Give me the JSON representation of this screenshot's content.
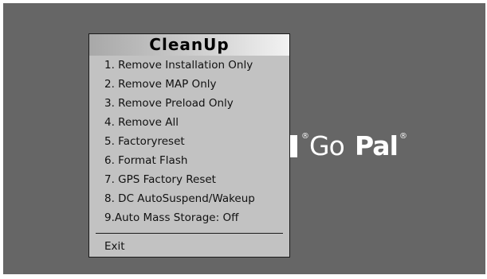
{
  "background": {
    "logo": {
      "reg_mark_1": "®",
      "brand_prefix": "Go",
      "brand_suffix": "Pal",
      "reg_mark_2": "®"
    }
  },
  "dialog": {
    "title": "CleanUp",
    "items": [
      {
        "label": "1. Remove Installation Only"
      },
      {
        "label": "2. Remove MAP Only"
      },
      {
        "label": "3. Remove Preload Only"
      },
      {
        "label": "4. Remove All"
      },
      {
        "label": "5. Factoryreset"
      },
      {
        "label": "6. Format Flash"
      },
      {
        "label": "7. GPS Factory Reset"
      },
      {
        "label": "8. DC AutoSuspend/Wakeup"
      },
      {
        "label": "9.Auto Mass Storage: Off"
      }
    ],
    "exit_label": "Exit"
  },
  "colors": {
    "screen_background": "#666666",
    "dialog_background": "#c2c2c2",
    "logo_color": "#ffffff"
  }
}
